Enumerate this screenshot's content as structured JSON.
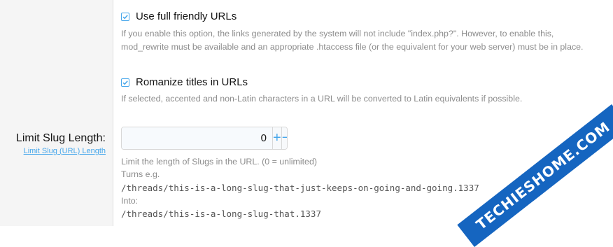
{
  "options": [
    {
      "label": "Use full friendly URLs",
      "checked": true,
      "hint_lines": [
        "If you enable this option, the links generated by the system will not include \"index.php?\". However, to enable this,",
        "mod_rewrite must be available and an appropriate .htaccess file (or the equivalent for your web server) must be in place."
      ]
    },
    {
      "label": "Romanize titles in URLs",
      "checked": true,
      "hint_lines": [
        "If selected, accented and non-Latin characters in a URL will be converted to Latin equivalents if possible."
      ]
    }
  ],
  "slug": {
    "label": "Limit Slug Length:",
    "sublabel": "Limit Slug (URL) Length",
    "value": "0",
    "plus_glyph": "+",
    "minus_glyph": "−",
    "explain": "Limit the length of Slugs in the URL. (0 = unlimited)",
    "turns": "Turns e.g.",
    "example_long": "/threads/this-is-a-long-slug-that-just-keeps-on-going-and-going.1337",
    "into": "Into:",
    "example_short": "/threads/this-is-a-long-slug-that.1337"
  },
  "watermark": {
    "text": "TECHIESHOME.COM"
  },
  "colors": {
    "accent": "#47a7eb",
    "hint": "#8c8c8c",
    "left_bg": "#f5f5f5"
  }
}
